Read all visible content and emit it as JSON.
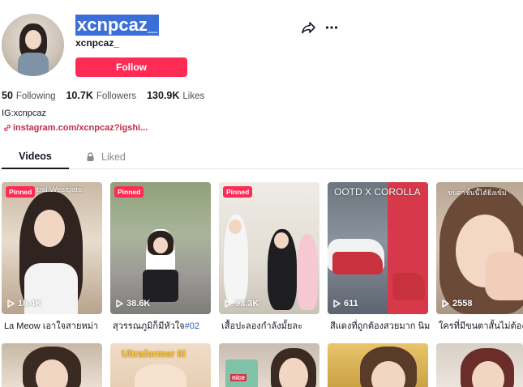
{
  "profile": {
    "username": "xcnpcaz_",
    "nickname": "xcnpcaz_",
    "follow_label": "Follow",
    "bio": "IG:xcnpcaz",
    "link": "instagram.com/xcnpcaz?igshi..."
  },
  "stats": [
    {
      "value": "50",
      "label": "Following"
    },
    {
      "value": "10.7K",
      "label": "Followers"
    },
    {
      "value": "130.9K",
      "label": "Likes"
    }
  ],
  "tabs": {
    "videos": "Videos",
    "liked": "Liked"
  },
  "videos": [
    {
      "overlay": "Central Westgate",
      "pinned": "Pinned",
      "views": "18.4K",
      "title": "La Meow เอาใจสายหม่า",
      "tag": ""
    },
    {
      "overlay": "",
      "pinned": "Pinned",
      "views": "38.6K",
      "title": "สุวรรณภูมิก็มีหัวใจ",
      "tag": "#02"
    },
    {
      "overlay": "",
      "pinned": "Pinned",
      "views": "93.3K",
      "title": "เสื้อปะลองกำลังมั้ยละ",
      "tag": ""
    },
    {
      "overlay": "OOTD X COROLLA",
      "pinned": "",
      "views": "611",
      "title": "สีแดงที่ถูกต้องสวยมาก นิม",
      "tag": ""
    },
    {
      "overlay": "ขนตาชั้นนี้ได้ยิ่งเข้ม",
      "pinned": "",
      "views": "2558",
      "title": "ใครที่มีขนตาสั้นไม่ต้อง",
      "tag": ""
    }
  ],
  "row2": [
    {
      "overlay": ""
    },
    {
      "overlay": "Ultraformer III"
    },
    {
      "overlay": "nice"
    },
    {
      "overlay": ""
    },
    {
      "overlay": ""
    }
  ],
  "colors": {
    "accent": "#fe2c55",
    "selection": "#3b6ed6",
    "link": "#c42a4a"
  },
  "icons": [
    "share-icon",
    "more-icon",
    "link-icon",
    "lock-icon",
    "play-icon"
  ]
}
